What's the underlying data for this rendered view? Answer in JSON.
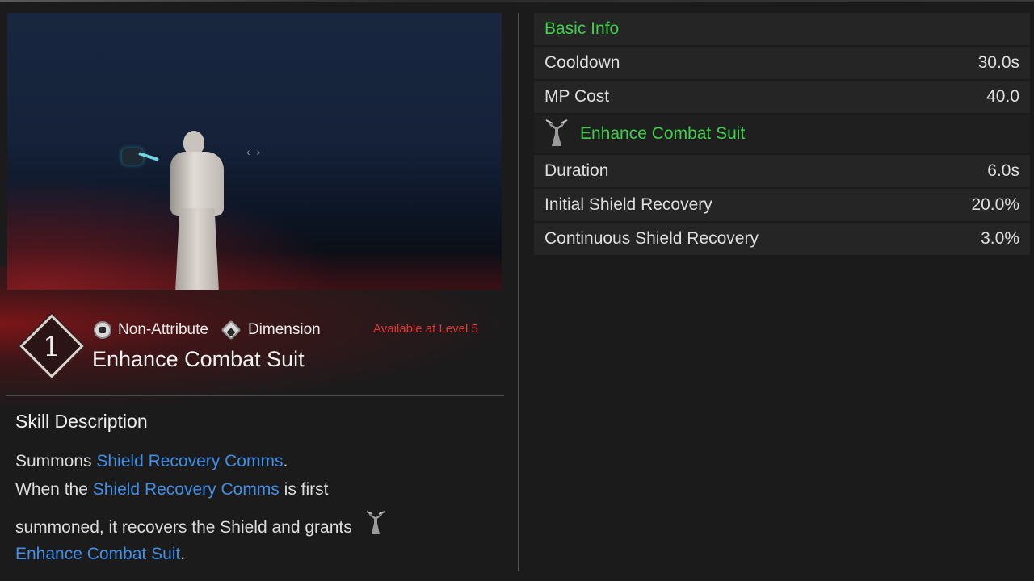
{
  "skill": {
    "level": "1",
    "attribute": "Non-Attribute",
    "type": "Dimension",
    "availability": "Available at Level 5",
    "name": "Enhance Combat Suit"
  },
  "description": {
    "heading": "Skill Description",
    "line1_prefix": "Summons ",
    "line1_link": "Shield Recovery Comms",
    "line1_suffix": ".",
    "line2_prefix": "When the ",
    "line2_link": "Shield Recovery Comms",
    "line2_suffix": " is first",
    "line3": "summoned, it recovers the Shield and grants",
    "line4_link": "Enhance Combat Suit",
    "line4_suffix": "."
  },
  "stats": {
    "basic_info_label": "Basic Info",
    "basic": [
      {
        "label": "Cooldown",
        "value": "30.0s"
      },
      {
        "label": "MP Cost",
        "value": "40.0"
      }
    ],
    "buff_label": "Enhance Combat Suit",
    "buff": [
      {
        "label": "Duration",
        "value": "6.0s"
      },
      {
        "label": "Initial Shield Recovery",
        "value": "20.0%"
      },
      {
        "label": "Continuous Shield Recovery",
        "value": "3.0%"
      }
    ]
  },
  "preview": {
    "arrows": "‹ ›"
  },
  "colors": {
    "section": "#3fcf4a",
    "link": "#3f8ee8",
    "warning": "#e03838"
  }
}
